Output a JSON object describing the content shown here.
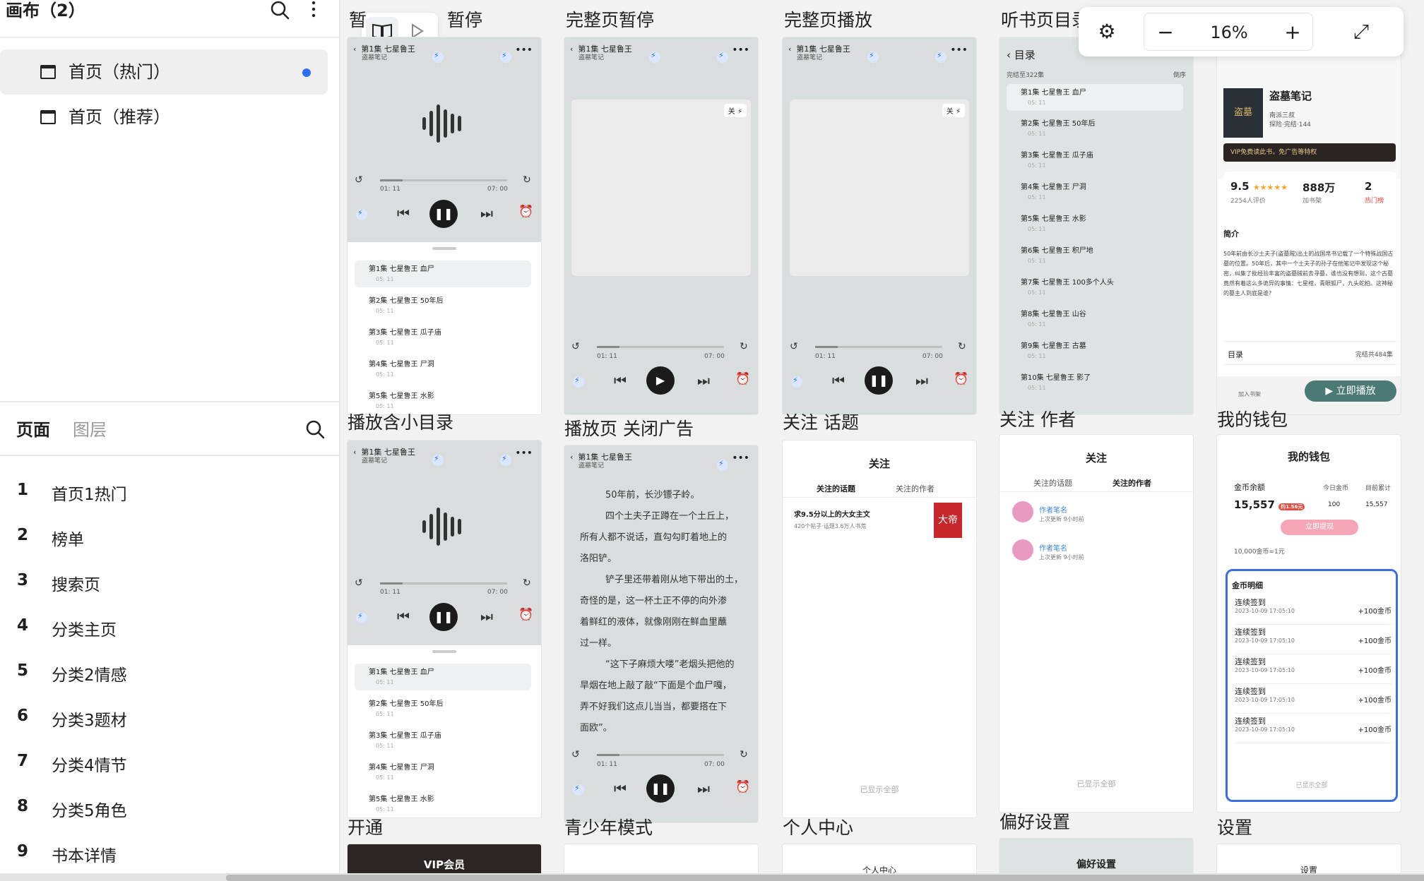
{
  "sidebar": {
    "title": "画布（2）",
    "canvases": [
      {
        "label": "首页（热门）",
        "selected": true
      },
      {
        "label": "首页（推荐）",
        "selected": false
      }
    ],
    "tabs": {
      "pages": "页面",
      "layers": "图层"
    },
    "pages": [
      {
        "num": "1",
        "name": "首页1热门"
      },
      {
        "num": "2",
        "name": "榜单"
      },
      {
        "num": "3",
        "name": "搜索页"
      },
      {
        "num": "4",
        "name": "分类主页"
      },
      {
        "num": "5",
        "name": "分类2情感"
      },
      {
        "num": "6",
        "name": "分类3题材"
      },
      {
        "num": "7",
        "name": "分类4情节"
      },
      {
        "num": "8",
        "name": "分类5角色"
      },
      {
        "num": "9",
        "name": "书本详情"
      }
    ]
  },
  "toolbar": {
    "zoom": "16%",
    "accent": "#2e6cf6"
  },
  "frames": {
    "row1": [
      "暂",
      "暂停",
      "完整页暂停",
      "完整页播放",
      "听书页目录"
    ],
    "row2": [
      "播放含小目录",
      "播放页 关闭广告",
      "关注 话题",
      "关注 作者",
      "我的钱包"
    ],
    "row3": [
      "开通",
      "青少年模式",
      "个人中心",
      "偏好设置",
      "设置"
    ]
  },
  "player": {
    "episode": "第1集  七星鲁王",
    "book": "盗墓笔记",
    "elapsed": "01: 11",
    "total": "07: 00",
    "ad_close": "关"
  },
  "episodes": [
    {
      "title": "第1集  七星鲁王  血尸",
      "dur": "05: 11"
    },
    {
      "title": "第2集  七星鲁王  50年后",
      "dur": "05: 11"
    },
    {
      "title": "第3集  七星鲁王  瓜子庙",
      "dur": "05: 11"
    },
    {
      "title": "第4集  七星鲁王  尸洞",
      "dur": "05: 11"
    },
    {
      "title": "第5集  七星鲁王  水影",
      "dur": "05: 11"
    },
    {
      "title": "第6集  七星鲁王  积尸地",
      "dur": "05: 11"
    },
    {
      "title": "第7集  七星鲁王  100多个人头",
      "dur": "05: 11"
    },
    {
      "title": "第8集  七星鲁王  山谷",
      "dur": "05: 11"
    },
    {
      "title": "第9集  七星鲁王  古墓",
      "dur": "05: 11"
    },
    {
      "title": "第10集  七星鲁王  影了",
      "dur": "05: 11"
    }
  ],
  "toc": {
    "title": "目录",
    "status": "完结至322集",
    "order": "倒序"
  },
  "reading": [
    "50年前，长沙镖子岭。",
    "四个土夫子正蹲在一个土丘上，",
    "所有人都不说话，直勾勾盯着地上的",
    "洛阳铲。",
    "铲子里还带着刚从地下带出的土，",
    "奇怪的是，这一杯土正不停的向外渗",
    "着鲜红的液体，就像刚刚在鲜血里蘸",
    "过一样。",
    "“这下子麻烦大喽”老烟头把他的",
    "旱烟在地上敲了敲“下面是个血尸嘎，",
    "弄不好我们这点儿当当，都要搭在下",
    "面欧”。"
  ],
  "follow_topic": {
    "title": "关注",
    "tab1": "关注的话题",
    "tab2": "关注的作者",
    "item": "求9.5分以上的大女主文",
    "meta": "420个帖子·话题3.6万人书荒",
    "end": "已显示全部"
  },
  "follow_author": {
    "title": "关注",
    "tab1": "关注的话题",
    "tab2": "关注的作者",
    "name": "作者笔名",
    "meta": "上次更新  9小时前",
    "end": "已显示全部"
  },
  "book_detail": {
    "name": "盗墓笔记",
    "author": "南派三叔",
    "tags": "探险·完结·144",
    "vip": "VIP免费读此书，免广告等特权",
    "score": "9.5",
    "ratings": "2254人评价",
    "shelf": "888万",
    "shelf_label": "加书架",
    "rank": "2",
    "rank_label": "热门榜",
    "intro_title": "简介",
    "intro": "50年前由长沙土夫子(盗墓贼)出土的战国帛书记载了一个特殊战国古墓的位置。50年后，其中一个土夫子的孙子在他笔记中发现这个秘密，纠集了批经验丰富的盗墓贼前去寻墓，谁也没有想到，这个古墓竟然有着这么多诡异的事情：七星棺，青眼狐尸，九头蛇柏。这神秘的墓主人到底是谁?",
    "toc_label": "目录",
    "toc_status": "完结共484集",
    "add_shelf": "加入书架",
    "play": "▶ 立即播放"
  },
  "wallet": {
    "title": "我的钱包",
    "balance_label": "金币余额",
    "balance": "15,557",
    "badge": "约1.56元",
    "today_label": "今日金币",
    "today": "100",
    "total_label": "目前累计",
    "total": "15,557",
    "withdraw": "立即提现",
    "rate": "10,000金币=1元",
    "detail_title": "金币明细",
    "rows": [
      {
        "name": "连续签到",
        "time": "2023-10-09  17:05:10",
        "amount": "+100金币"
      },
      {
        "name": "连续签到",
        "time": "2023-10-09  17:05:10",
        "amount": "+100金币"
      },
      {
        "name": "连续签到",
        "time": "2023-10-09  17:05:10",
        "amount": "+100金币"
      },
      {
        "name": "连续签到",
        "time": "2023-10-09  17:05:10",
        "amount": "+100金币"
      },
      {
        "name": "连续签到",
        "time": "2023-10-09  17:05:10",
        "amount": "+100金币"
      }
    ],
    "end": "已显示全部"
  },
  "vip": {
    "title": "VIP会员"
  },
  "personal": {
    "title": "个人中心"
  },
  "prefs": {
    "title": "偏好设置"
  },
  "settings": {
    "title": "设置"
  }
}
